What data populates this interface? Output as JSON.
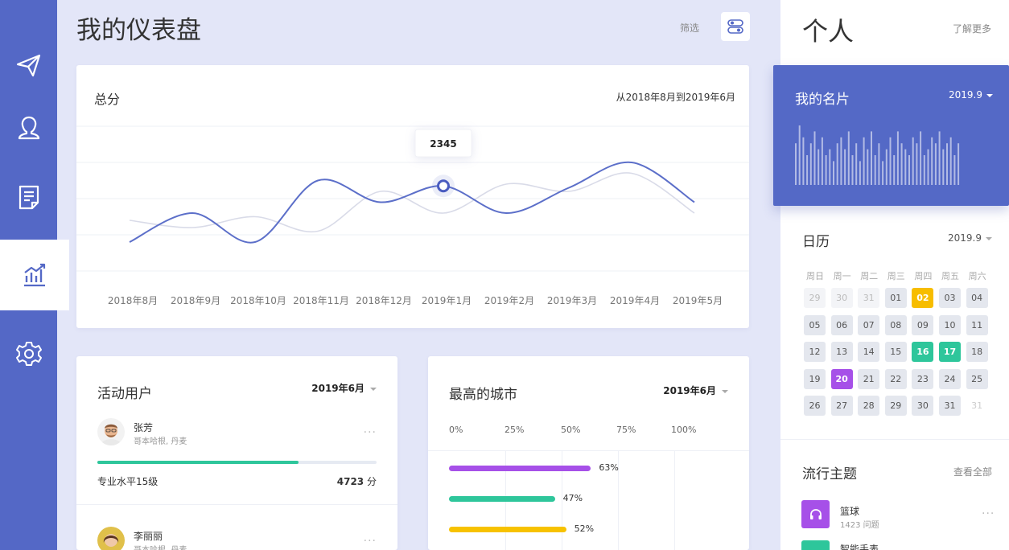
{
  "header": {
    "title": "我的仪表盘",
    "filter_label": "筛选"
  },
  "sidebar": {
    "items": [
      {
        "name": "send",
        "icon": "send-icon"
      },
      {
        "name": "profile",
        "icon": "user-icon"
      },
      {
        "name": "documents",
        "icon": "document-icon"
      },
      {
        "name": "analytics",
        "icon": "chart-icon",
        "active": true
      },
      {
        "name": "settings",
        "icon": "gear-icon"
      }
    ]
  },
  "score_card": {
    "title": "总分",
    "range": "从2018年8月到2019年6月",
    "tooltip_value": "2345"
  },
  "chart_data": {
    "type": "line",
    "categories": [
      "2018年8月",
      "2018年9月",
      "2018年10月",
      "2018年11月",
      "2018年12月",
      "2019年1月",
      "2019年2月",
      "2019年3月",
      "2019年4月",
      "2019年5月"
    ],
    "series": [
      {
        "color": "#5c6fc9",
        "values": [
          0.8,
          1.6,
          0.8,
          2.5,
          1.9,
          2.35,
          1.6,
          2.3,
          3.0,
          1.9
        ]
      },
      {
        "color": "#d9dbe8",
        "values": [
          1.4,
          1.2,
          1.5,
          1.1,
          2.2,
          1.6,
          2.4,
          2.2,
          2.7,
          1.6
        ]
      }
    ],
    "highlight_index": 5,
    "highlight_value": "2345",
    "grid": true,
    "ylim": [
      0,
      4
    ]
  },
  "users_card": {
    "title": "活动用户",
    "period": "2019年6月",
    "users": [
      {
        "name": "张芳",
        "location": "哥本哈根, 丹麦",
        "level": "专业水平15级",
        "score": "4723",
        "score_unit": "分",
        "progress": 0.72,
        "more": "···"
      },
      {
        "name": "李丽丽",
        "location": "哥本哈根, 丹麦",
        "more": "···"
      }
    ]
  },
  "cities_card": {
    "title": "最高的城市",
    "period": "2019年6月",
    "axis": [
      "0%",
      "25%",
      "50%",
      "75%",
      "100%"
    ],
    "bars": [
      {
        "value": 63,
        "label": "63%",
        "color": "#a650e8"
      },
      {
        "value": 47,
        "label": "47%",
        "color": "#2ec69b"
      },
      {
        "value": 52,
        "label": "52%",
        "color": "#f7c200"
      }
    ]
  },
  "right_panel": {
    "title": "个人",
    "more": "了解更多",
    "namecard": {
      "title": "我的名片",
      "date": "2019.9",
      "bar_values": [
        0.7,
        1.0,
        0.8,
        0.5,
        0.7,
        0.9,
        0.6,
        0.8,
        0.5,
        0.6,
        0.4,
        0.7,
        0.8,
        0.6,
        0.9,
        0.5,
        0.7,
        0.4,
        0.8,
        0.6,
        0.9,
        0.5,
        0.7,
        0.4,
        0.6,
        0.8,
        0.5,
        0.9,
        0.7,
        0.6,
        0.5,
        0.8,
        0.7,
        0.9,
        0.5,
        0.6,
        0.8,
        0.7,
        0.9,
        0.6,
        0.7,
        0.8,
        0.5,
        0.7
      ]
    },
    "calendar": {
      "title": "日历",
      "date": "2019.9",
      "weekdays": [
        "周日",
        "周一",
        "周二",
        "周三",
        "周四",
        "周五",
        "周六"
      ],
      "days": [
        {
          "d": "29",
          "s": "muted"
        },
        {
          "d": "30",
          "s": "muted"
        },
        {
          "d": "31",
          "s": "muted"
        },
        {
          "d": "01",
          "s": ""
        },
        {
          "d": "02",
          "s": "yellow"
        },
        {
          "d": "03",
          "s": ""
        },
        {
          "d": "04",
          "s": ""
        },
        {
          "d": "05",
          "s": ""
        },
        {
          "d": "06",
          "s": ""
        },
        {
          "d": "07",
          "s": ""
        },
        {
          "d": "08",
          "s": ""
        },
        {
          "d": "09",
          "s": ""
        },
        {
          "d": "10",
          "s": ""
        },
        {
          "d": "11",
          "s": ""
        },
        {
          "d": "12",
          "s": ""
        },
        {
          "d": "13",
          "s": ""
        },
        {
          "d": "14",
          "s": ""
        },
        {
          "d": "15",
          "s": ""
        },
        {
          "d": "16",
          "s": "green"
        },
        {
          "d": "17",
          "s": "green"
        },
        {
          "d": "18",
          "s": ""
        },
        {
          "d": "19",
          "s": ""
        },
        {
          "d": "20",
          "s": "purple"
        },
        {
          "d": "21",
          "s": ""
        },
        {
          "d": "22",
          "s": ""
        },
        {
          "d": "23",
          "s": ""
        },
        {
          "d": "24",
          "s": ""
        },
        {
          "d": "25",
          "s": ""
        },
        {
          "d": "26",
          "s": ""
        },
        {
          "d": "27",
          "s": ""
        },
        {
          "d": "28",
          "s": ""
        },
        {
          "d": "29",
          "s": ""
        },
        {
          "d": "30",
          "s": ""
        },
        {
          "d": "31",
          "s": ""
        },
        {
          "d": "31",
          "s": "blank"
        }
      ]
    },
    "topics": {
      "title": "流行主题",
      "more": "查看全部",
      "items": [
        {
          "name": "篮球",
          "count": "1423 问题",
          "color": "#a650e8",
          "icon": "headphones-icon",
          "more": "···"
        },
        {
          "name": "智能手表",
          "color": "#2ec69b",
          "icon": "watch-icon"
        }
      ]
    }
  }
}
